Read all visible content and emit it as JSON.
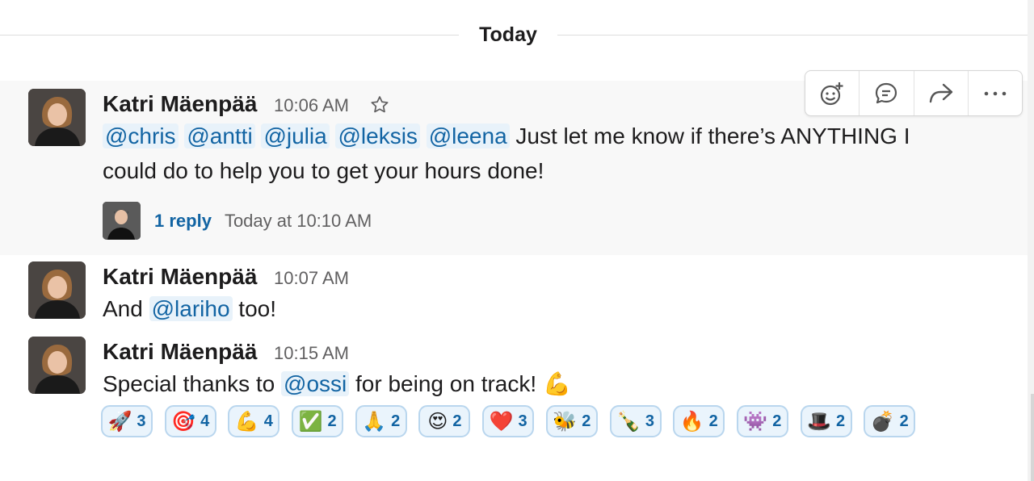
{
  "divider": {
    "label": "Today"
  },
  "toolbar": {
    "actions": [
      {
        "icon": "add-reaction-icon"
      },
      {
        "icon": "reply-thread-icon"
      },
      {
        "icon": "share-icon"
      },
      {
        "icon": "more-actions-icon"
      }
    ]
  },
  "messages": [
    {
      "author": "Katri Mäenpää",
      "time": "10:06 AM",
      "mentions": [
        "@chris",
        "@antti",
        "@julia",
        "@leksis",
        "@leena"
      ],
      "text_line1": "Just let me know if there’s ANYTHING I",
      "text_line2": "could do to help you to get your hours done!",
      "thread": {
        "reply_label": "1 reply",
        "reply_time": "Today at 10:10 AM"
      }
    },
    {
      "author": "Katri Mäenpää",
      "time": "10:07 AM",
      "text_before": "And",
      "mention": "@lariho",
      "text_after": "too!"
    },
    {
      "author": "Katri Mäenpää",
      "time": "10:15 AM",
      "text_before": "Special thanks to",
      "mention": "@ossi",
      "text_after": "for being on track!",
      "emoji": "💪",
      "reactions": [
        {
          "emoji": "🚀",
          "count": "3"
        },
        {
          "emoji": "🎯",
          "count": "4"
        },
        {
          "emoji": "💪",
          "count": "4"
        },
        {
          "emoji": "✅",
          "count": "2"
        },
        {
          "emoji": "🙏",
          "count": "2"
        },
        {
          "emoji": "😍",
          "count": "2"
        },
        {
          "emoji": "❤️",
          "count": "3"
        },
        {
          "emoji": "🐝",
          "count": "2"
        },
        {
          "emoji": "🍾",
          "count": "3"
        },
        {
          "emoji": "🔥",
          "count": "2"
        },
        {
          "emoji": "👾",
          "count": "2"
        },
        {
          "emoji": "🎩",
          "count": "2"
        },
        {
          "emoji": "💣",
          "count": "2"
        }
      ]
    }
  ],
  "colors": {
    "link": "#1264a3",
    "mention_bg": "#e8f2fa",
    "reaction_border": "#b9d6ee",
    "highlight_bg": "#f8f8f8"
  }
}
